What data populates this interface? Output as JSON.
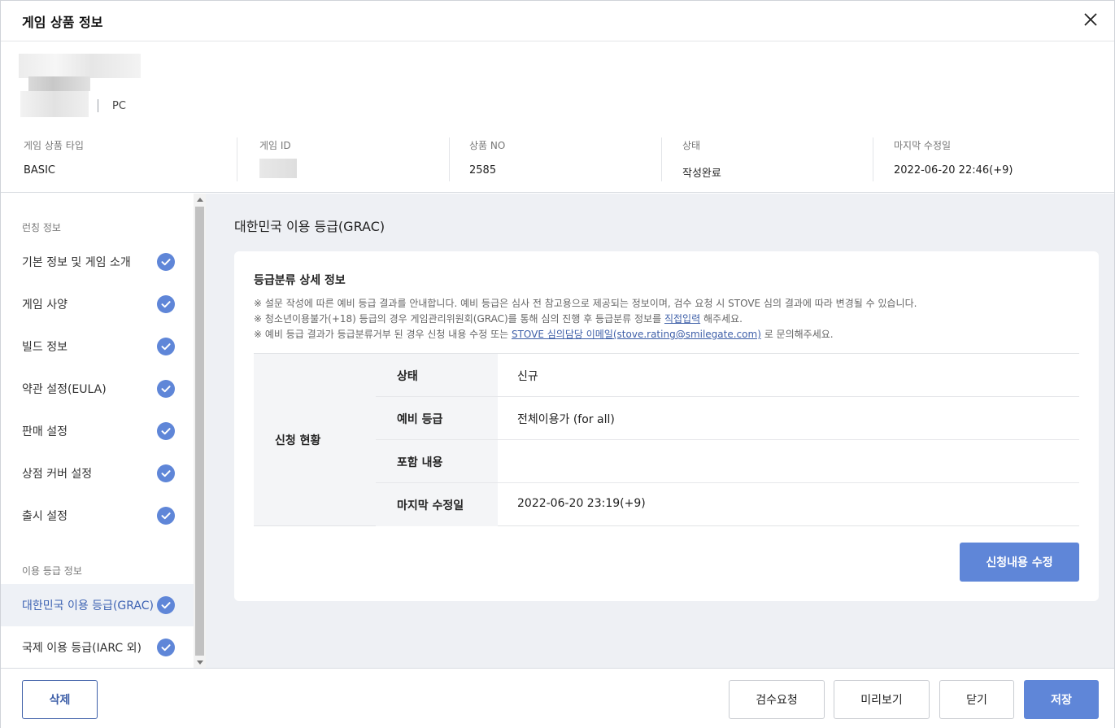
{
  "dialog": {
    "title": "게임 상품 정보"
  },
  "product": {
    "platform": "PC",
    "meta": [
      {
        "label": "게임 상품 타입",
        "value": "BASIC"
      },
      {
        "label": "게임 ID",
        "value": ""
      },
      {
        "label": "상품 NO",
        "value": "2585"
      },
      {
        "label": "상태",
        "value": "작성완료"
      },
      {
        "label": "마지막 수정일",
        "value": "2022-06-20 22:46(+9)"
      }
    ]
  },
  "sidebar": {
    "section1": "런칭 정보",
    "section2": "이용 등급 정보",
    "items": [
      {
        "label": "기본 정보 및 게임 소개"
      },
      {
        "label": "게임 사양"
      },
      {
        "label": "빌드 정보"
      },
      {
        "label": "약관 설정(EULA)"
      },
      {
        "label": "판매 설정"
      },
      {
        "label": "상점 커버 설정"
      },
      {
        "label": "출시 설정"
      },
      {
        "label": "대한민국 이용 등급(GRAC)"
      },
      {
        "label": "국제 이용 등급(IARC 외)"
      }
    ],
    "active_index": 7
  },
  "main": {
    "heading": "대한민국 이용 등급(GRAC)",
    "card_title": "등급분류 상세 정보",
    "notes": {
      "n1": "※ 설문 작성에 따른 예비 등급 결과를 안내합니다. 예비 등급은 심사 전 참고용으로 제공되는 정보이며, 검수 요청 시 STOVE 심의 결과에 따라 변경될 수 있습니다.",
      "n2_pre": "※ 청소년이용불가(+18) 등급의 경우 게임관리위원회(GRAC)를 통해 심의 진행 후 등급분류 정보를 ",
      "n2_link": "직접입력",
      "n2_post": " 해주세요.",
      "n3_pre": "※ 예비 등급 결과가 등급분류거부 된 경우 신청 내용 수정 또는 ",
      "n3_link": "STOVE 심의담당 이메일(stove.rating@smilegate.com)",
      "n3_post": " 로 문의해주세요."
    },
    "table": {
      "group_label": "신청 현황",
      "rows": [
        {
          "label": "상태",
          "value": "신규"
        },
        {
          "label": "예비 등급",
          "value": "전체이용가 (for all)"
        },
        {
          "label": "포함 내용",
          "value": ""
        },
        {
          "label": "마지막 수정일",
          "value": "2022-06-20 23:19(+9)"
        }
      ]
    },
    "edit_button": "신청내용 수정"
  },
  "footer": {
    "delete": "삭제",
    "review": "검수요청",
    "preview": "미리보기",
    "close": "닫기",
    "save": "저장"
  },
  "colors": {
    "accent": "#5f86d8",
    "link": "#3e5fa8",
    "active_bg": "#eef1f6"
  },
  "icons": {
    "close": "close-icon",
    "check": "check-circle-icon"
  }
}
